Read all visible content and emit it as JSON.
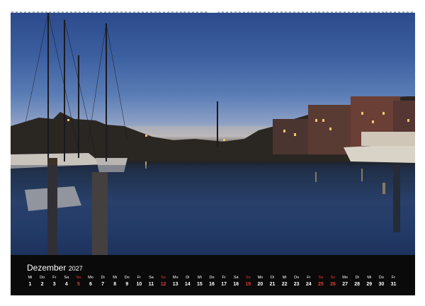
{
  "calendar": {
    "month": "Dezember",
    "year": "2027",
    "accent_color": "#e23b3b",
    "days": [
      {
        "name": "Mi",
        "num": "1",
        "red": false
      },
      {
        "name": "Do",
        "num": "2",
        "red": false
      },
      {
        "name": "Fr",
        "num": "3",
        "red": false
      },
      {
        "name": "Sa",
        "num": "4",
        "red": false
      },
      {
        "name": "So",
        "num": "5",
        "red": true
      },
      {
        "name": "Mo",
        "num": "6",
        "red": false
      },
      {
        "name": "Di",
        "num": "7",
        "red": false
      },
      {
        "name": "Mi",
        "num": "8",
        "red": false
      },
      {
        "name": "Do",
        "num": "9",
        "red": false
      },
      {
        "name": "Fr",
        "num": "10",
        "red": false
      },
      {
        "name": "Sa",
        "num": "11",
        "red": false
      },
      {
        "name": "So",
        "num": "12",
        "red": true
      },
      {
        "name": "Mo",
        "num": "13",
        "red": false
      },
      {
        "name": "Di",
        "num": "14",
        "red": false
      },
      {
        "name": "Mi",
        "num": "15",
        "red": false
      },
      {
        "name": "Do",
        "num": "16",
        "red": false
      },
      {
        "name": "Fr",
        "num": "17",
        "red": false
      },
      {
        "name": "Sa",
        "num": "18",
        "red": false
      },
      {
        "name": "So",
        "num": "19",
        "red": true
      },
      {
        "name": "Mo",
        "num": "20",
        "red": false
      },
      {
        "name": "Di",
        "num": "21",
        "red": false
      },
      {
        "name": "Mi",
        "num": "22",
        "red": false
      },
      {
        "name": "Do",
        "num": "23",
        "red": false
      },
      {
        "name": "Fr",
        "num": "24",
        "red": false
      },
      {
        "name": "Sa",
        "num": "25",
        "red": true
      },
      {
        "name": "So",
        "num": "26",
        "red": true
      },
      {
        "name": "Mo",
        "num": "27",
        "red": false
      },
      {
        "name": "Di",
        "num": "28",
        "red": false
      },
      {
        "name": "Mi",
        "num": "29",
        "red": false
      },
      {
        "name": "Do",
        "num": "30",
        "red": false
      },
      {
        "name": "Fr",
        "num": "31",
        "red": false
      }
    ]
  }
}
